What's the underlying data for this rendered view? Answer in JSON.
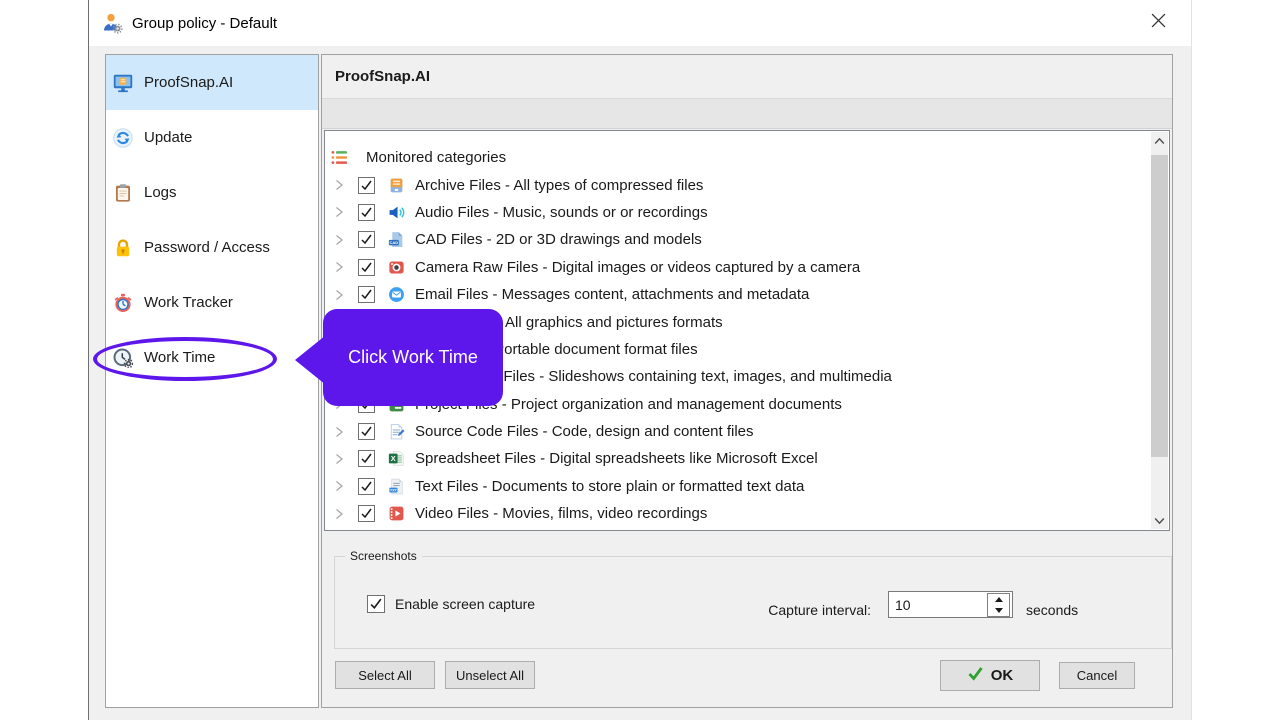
{
  "window": {
    "title": "Group policy - Default"
  },
  "sidebar": {
    "items": [
      {
        "label": "ProofSnap.AI",
        "icon": "monitor-icon",
        "selected": true
      },
      {
        "label": "Update",
        "icon": "sync-icon",
        "selected": false
      },
      {
        "label": "Logs",
        "icon": "clipboard-icon",
        "selected": false
      },
      {
        "label": "Password / Access",
        "icon": "lock-icon",
        "selected": false
      },
      {
        "label": "Work Tracker",
        "icon": "stopwatch-icon",
        "selected": false
      },
      {
        "label": "Work Time",
        "icon": "clock-gear-icon",
        "selected": false
      }
    ]
  },
  "main": {
    "header": "ProofSnap.AI",
    "tree": {
      "root": "Monitored categories",
      "items": [
        {
          "label": "Archive Files - All types of compressed files",
          "icon": "archive-icon",
          "checked": true
        },
        {
          "label": "Audio Files - Music, sounds or or recordings",
          "icon": "audio-icon",
          "checked": true
        },
        {
          "label": "CAD Files - 2D or 3D drawings and models",
          "icon": "cad-icon",
          "checked": true
        },
        {
          "label": "Camera Raw Files - Digital images or videos captured by a camera",
          "icon": "camera-icon",
          "checked": true
        },
        {
          "label": "Email Files - Messages content, attachments and metadata",
          "icon": "email-icon",
          "checked": true
        },
        {
          "label": "Image Files - All graphics and pictures formats",
          "icon": "image-icon",
          "checked": true
        },
        {
          "label": "PDF Files - Portable document format files",
          "icon": "pdf-icon",
          "checked": true
        },
        {
          "label": "Presentation Files - Slideshows containing text, images, and multimedia",
          "icon": "presentation-icon",
          "checked": true
        },
        {
          "label": "Project Files - Project organization and management documents",
          "icon": "project-icon",
          "checked": true
        },
        {
          "label": "Source Code Files - Code, design and content files",
          "icon": "source-code-icon",
          "checked": true
        },
        {
          "label": "Spreadsheet Files - Digital spreadsheets like Microsoft Excel",
          "icon": "spreadsheet-icon",
          "checked": true
        },
        {
          "label": "Text Files - Documents to store plain or formatted text data",
          "icon": "text-file-icon",
          "checked": true
        },
        {
          "label": "Video Files - Movies, films, video recordings",
          "icon": "video-icon",
          "checked": true
        }
      ]
    },
    "screenshots": {
      "legend": "Screenshots",
      "enable_label": "Enable screen capture",
      "enabled": true,
      "interval_label": "Capture interval:",
      "interval_value": "10",
      "unit": "seconds"
    },
    "buttons": {
      "select_all": "Select All",
      "unselect_all": "Unselect All",
      "ok": "OK",
      "cancel": "Cancel"
    }
  },
  "annotation": {
    "callout_text": "Click Work Time",
    "target": "Work Time",
    "accent_color": "#5e17eb"
  },
  "colors": {
    "selected_sidebar_bg": "#cfe8fb",
    "dialog_bg": "#f0f0f0",
    "ok_check_green": "#2ea12e",
    "accent_purple": "#5e17eb"
  }
}
